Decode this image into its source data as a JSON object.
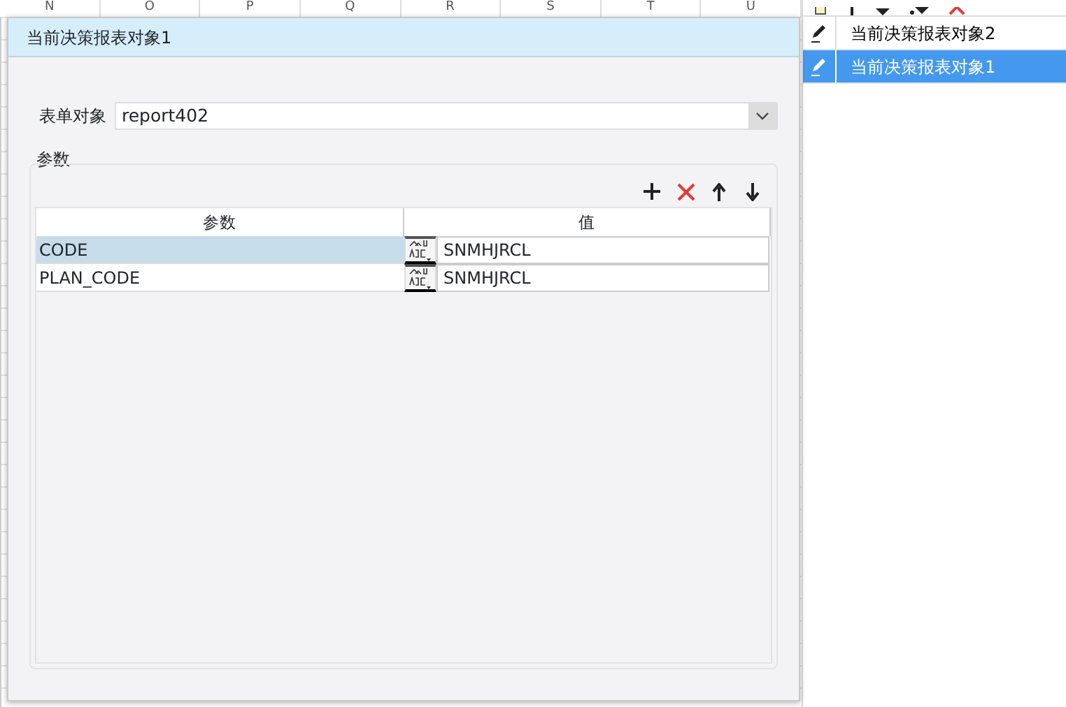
{
  "sheet": {
    "columns": [
      "N",
      "O",
      "P",
      "Q",
      "R",
      "S",
      "T",
      "U"
    ]
  },
  "dialog": {
    "title": "当前决策报表对象1",
    "form_object": {
      "label": "表单对象",
      "value": "report402"
    },
    "params": {
      "legend": "参数",
      "columns": [
        "参数",
        "值"
      ],
      "rows": [
        {
          "name": "CODE",
          "value": "SNMHJRCL",
          "selected": true
        },
        {
          "name": "PLAN_CODE",
          "value": "SNMHJRCL",
          "selected": false
        }
      ]
    }
  },
  "objects": [
    {
      "label": "当前决策报表对象2",
      "selected": false
    },
    {
      "label": "当前决策报表对象1",
      "selected": true
    }
  ]
}
